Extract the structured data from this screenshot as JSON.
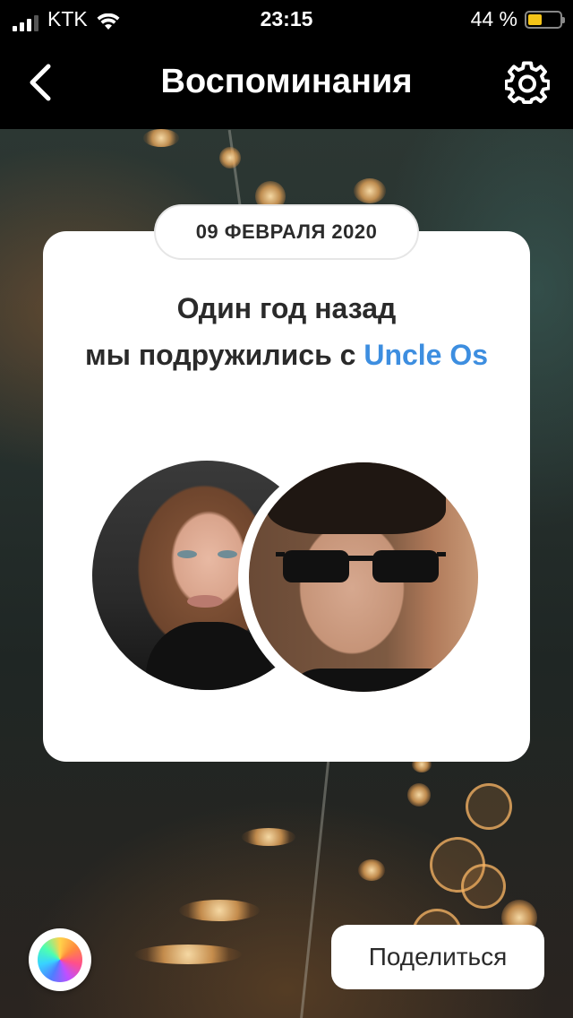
{
  "status_bar": {
    "carrier": "KTK",
    "time": "23:15",
    "battery_percent": "44 %",
    "battery_level": 0.44,
    "signal_bars": 3
  },
  "nav": {
    "title": "Воспоминания",
    "back_icon": "chevron-left-icon",
    "settings_icon": "gear-icon"
  },
  "card": {
    "date": "09 ФЕВРАЛЯ 2020",
    "headline_line1": "Один год назад",
    "headline_line2_prefix": "мы подружились с ",
    "friend_name": "Uncle Os",
    "friend_name_color": "#3d8ee0"
  },
  "bottom": {
    "share_label": "Поделиться",
    "color_picker_icon": "color-wheel-icon"
  }
}
